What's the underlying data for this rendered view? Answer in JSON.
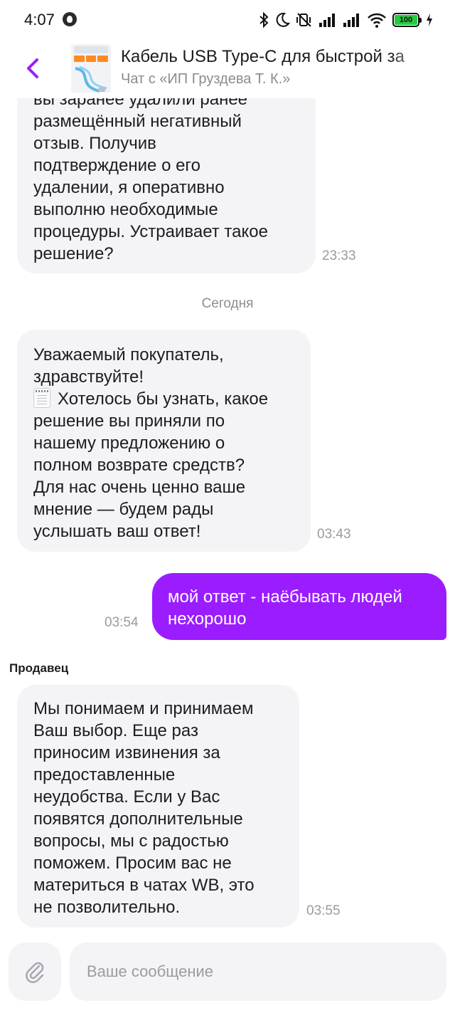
{
  "status_bar": {
    "time": "4:07",
    "battery": "100",
    "icons": [
      "vk-notification-icon",
      "bluetooth-icon",
      "moon-icon",
      "vibrate-off-icon",
      "signal-icon",
      "signal-icon",
      "wifi-icon",
      "battery-icon",
      "charging-icon"
    ]
  },
  "header": {
    "title": "Кабель USB Type-C для быстрой за",
    "subtitle": "Чат с «ИП Груздева Т. К.»",
    "thumb_label": "СВЕРХБЫСТРАЯ",
    "thumb_badges": [
      "120W",
      "2M",
      "6A"
    ],
    "accent": "#9b1dff"
  },
  "messages": [
    {
      "text": "вы заранее удалили ранее\nразмещённый негативный\nотзыв. Получив\nподтверждение о его\nудалении, я оперативно\nвыполню необходимые\nпроцедуры. Устраивает такое\nрешение?",
      "time": "23:33"
    },
    {
      "text_first": "Уважаемый покупатель,\nздравствуйте!",
      "icon": "notepad-icon",
      "text_rest": "Хотелось бы узнать, какое\nрешение вы приняли по\nнашему предложению о\nполном возврате средств?\nДля нас очень ценно ваше\nмнение — будем рады\nуслышать ваш ответ!",
      "time": "03:43"
    },
    {
      "text": "мой ответ - наёбывать людей\nнехорошо",
      "time": "03:54"
    },
    {
      "text": "Мы понимаем и принимаем\nВаш выбор. Еще раз\nприносим извинения за\nпредоставленные\nнеудобства. Если у Вас\nпоявятся дополнительные\nвопросы, мы с радостью\nпоможем. Просим вас не\nматериться в чатах WB, это\nне позволительно.",
      "time": "03:55"
    }
  ],
  "date_separator": "Сегодня",
  "seller_label": "Продавец",
  "composer": {
    "placeholder": "Ваше сообщение",
    "value": ""
  }
}
